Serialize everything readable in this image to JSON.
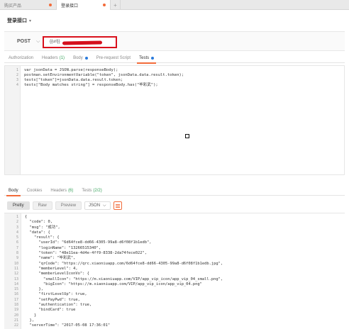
{
  "tabs": [
    {
      "label": "购买产品",
      "unsaved": true
    },
    {
      "label": "登录接口",
      "unsaved": true
    }
  ],
  "request": {
    "name": "登录接口",
    "method": "POST",
    "url": "{{url}}"
  },
  "request_tabs": [
    {
      "label": "Authorization"
    },
    {
      "label": "Headers",
      "count": "(1)"
    },
    {
      "label": "Body",
      "dot": true
    },
    {
      "label": "Pre-request Script"
    },
    {
      "label": "Tests",
      "dot": true,
      "active": true
    }
  ],
  "tests_code": [
    "var jsonData = JSON.parse(responseBody);",
    "postman.setEnvironmentVariable(\"token\", jsonData.data.result.token);",
    "tests[\"token\"]=jsonData.data.result.token;",
    "tests[\"Body matches string\"] = responseBody.has(\"毕彩武\");"
  ],
  "response_tabs": [
    {
      "label": "Body",
      "active": true
    },
    {
      "label": "Cookies"
    },
    {
      "label": "Headers",
      "count": "(6)"
    },
    {
      "label": "Tests",
      "count": "(2/2)"
    }
  ],
  "format": {
    "buttons": [
      "Pretty",
      "Raw",
      "Preview"
    ],
    "active": "Pretty",
    "type": "JSON"
  },
  "response_lines": [
    "{",
    "  \"code\": 0,",
    "  \"msg\": \"成功\",",
    "  \"data\": {",
    "    \"result\": {",
    "      \"userId\": \"6d64fce8-dd66-4305-99a8-d6f08f1b1edb\",",
    "      \"loginName\": \"13266515340\",",
    "      \"token\": \"48e11ea-4d4e-4ff9-8338-2da74fece022\",",
    "      \"name\": \"毕彩武\",",
    "      \"qrCode\": \"https://qrc.xiaoniuapp.com/6d64fce8-dd66-4305-99a8-d6f08f1b1edb.jpg\",",
    "      \"memberLevel\": 4,",
    "      \"memberLevelIconVo\": {",
    "        \"smallIcon\": \"https://m.xiaoniuapp.com/VIP/app_vip_icon/app_vip_04_small.png\",",
    "        \"bigIcon\": \"https://m.xiaoniuapp.com/VIP/app_vip_icon/app_vip_04.png\"",
    "      },",
    "      \"firstLevelUp\": true,",
    "      \"setPayPwd\": true,",
    "      \"authentication\": true,",
    "      \"bindCard\": true",
    "    }",
    "  },",
    "  \"serverTime\": \"2017-05-08 17:36:01\"",
    "}"
  ]
}
